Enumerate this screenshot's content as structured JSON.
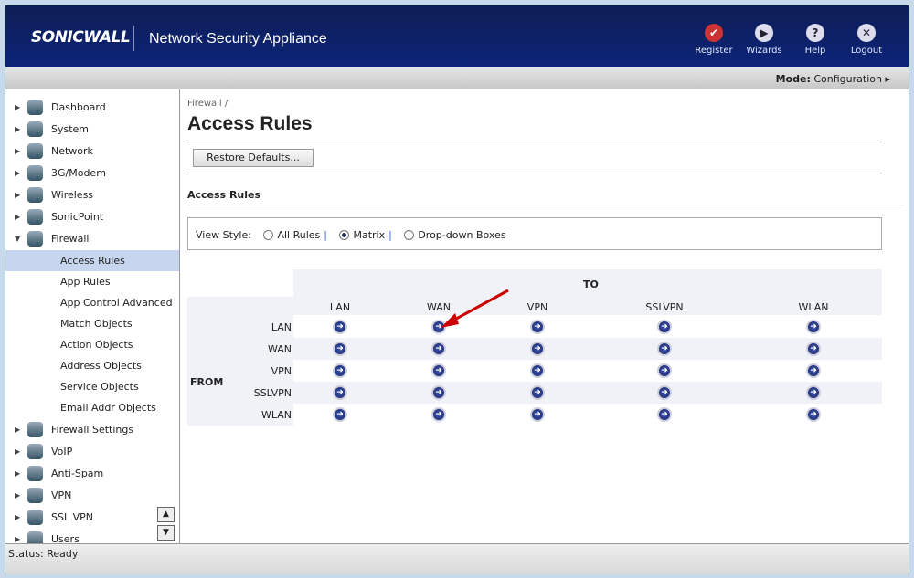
{
  "header": {
    "logo": "SONICWALL",
    "title": "Network Security Appliance",
    "buttons": [
      {
        "label": "Register",
        "icon": "check-icon"
      },
      {
        "label": "Wizards",
        "icon": "wizard-play-icon"
      },
      {
        "label": "Help",
        "icon": "help-icon"
      },
      {
        "label": "Logout",
        "icon": "close-icon"
      }
    ]
  },
  "mode": {
    "label": "Mode:",
    "value": "Configuration"
  },
  "sidebar": {
    "items": [
      "Dashboard",
      "System",
      "Network",
      "3G/Modem",
      "Wireless",
      "SonicPoint",
      "Firewall"
    ],
    "subitems": [
      "Access Rules",
      "App Rules",
      "App Control Advanced",
      "Match Objects",
      "Action Objects",
      "Address Objects",
      "Service Objects",
      "Email Addr Objects"
    ],
    "items2": [
      "Firewall Settings",
      "VoIP",
      "Anti-Spam",
      "VPN",
      "SSL VPN",
      "Users"
    ]
  },
  "breadcrumb": "Firewall /",
  "page_title": "Access Rules",
  "restore_label": "Restore Defaults...",
  "section_title": "Access Rules",
  "view_style": {
    "label": "View Style:",
    "options": [
      "All Rules",
      "Matrix",
      "Drop-down Boxes"
    ],
    "selected": "Matrix",
    "sep": "|"
  },
  "matrix": {
    "to_label": "TO",
    "from_label": "FROM",
    "columns": [
      "LAN",
      "WAN",
      "VPN",
      "SSLVPN",
      "WLAN"
    ],
    "rows": [
      "LAN",
      "WAN",
      "VPN",
      "SSLVPN",
      "WLAN"
    ]
  },
  "status": "Status: Ready"
}
